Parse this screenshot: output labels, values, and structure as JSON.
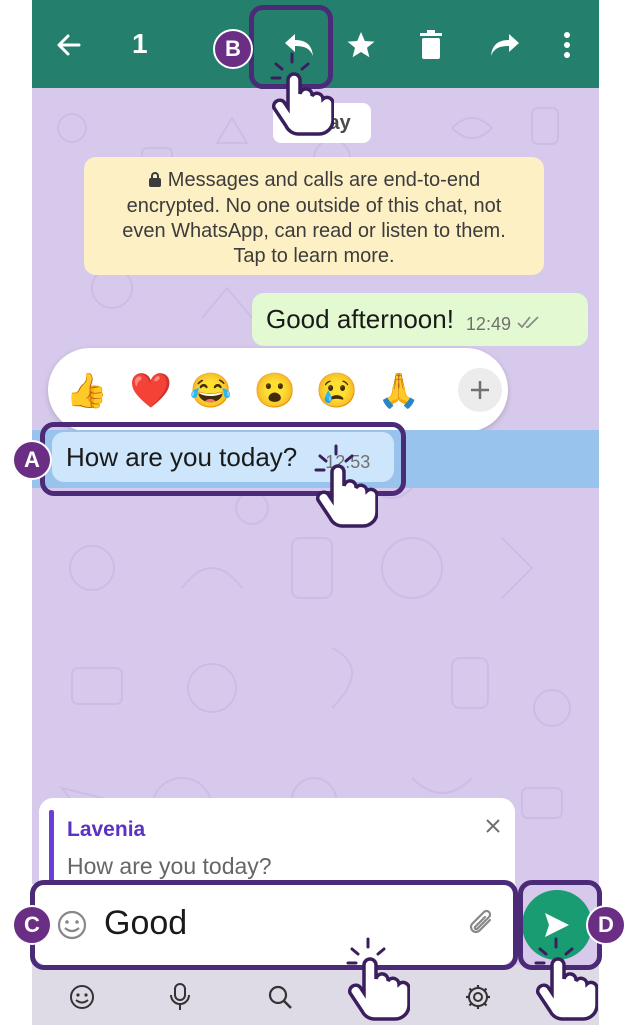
{
  "topbar": {
    "selected_count": "1",
    "icons": [
      "back-arrow-icon",
      "reply-icon",
      "star-icon",
      "delete-icon",
      "forward-icon",
      "more-icon"
    ],
    "color": "#24806c"
  },
  "date_chip": "Today",
  "encryption_notice": {
    "line1": "Messages and calls are end-to-end",
    "line2": "encrypted. No one outside of this chat, not",
    "line3": "even WhatsApp, can read or listen to them.",
    "line4": "Tap to learn more."
  },
  "outgoing_message": {
    "text": "Good afternoon!",
    "time": "12:49"
  },
  "reactions": [
    "👍",
    "❤️",
    "😂",
    "😮",
    "😢",
    "🙏"
  ],
  "incoming_message": {
    "text": "How are you today?",
    "time": "12:53"
  },
  "reply_preview": {
    "name": "Lavenia",
    "text": "How are you today?"
  },
  "input": {
    "value": "Good"
  },
  "keyboard_icons": [
    "smiley-icon",
    "microphone-icon",
    "search-icon",
    "gear-icon"
  ],
  "callouts": {
    "a": "A",
    "b": "B",
    "c": "C",
    "d": "D"
  },
  "colors": {
    "callout": "#6a2f84",
    "send": "#1a9c73",
    "selection": "#98c3ec"
  }
}
